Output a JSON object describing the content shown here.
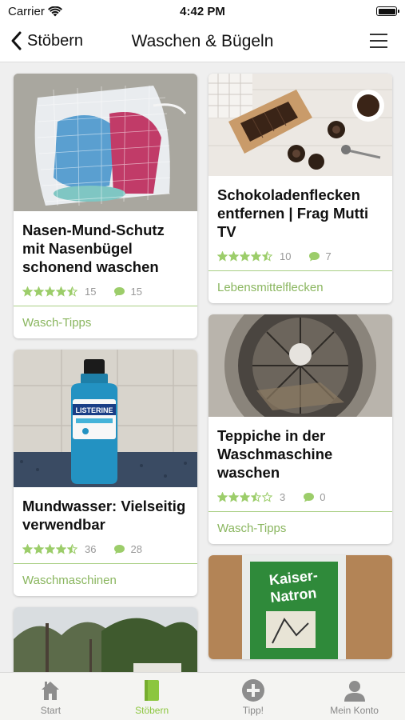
{
  "status": {
    "carrier": "Carrier",
    "time": "4:42 PM"
  },
  "nav": {
    "back_label": "Stöbern",
    "title": "Waschen & Bügeln"
  },
  "cards_left": [
    {
      "title": "Nasen-Mund-Schutz mit Nasenbügel schonend waschen",
      "rating": 4.5,
      "rating_count": "15",
      "comment_count": "15",
      "category": "Wasch-Tipps",
      "image": "mesh-laundry-bag-with-masks"
    },
    {
      "title": "Mundwasser: Vielseitig verwendbar",
      "rating": 4.5,
      "rating_count": "36",
      "comment_count": "28",
      "category": "Waschmaschinen",
      "image": "listerine-mouthwash-bottle"
    },
    {
      "image": "garden-trees"
    }
  ],
  "cards_right": [
    {
      "title": "Schokoladenflecken entfernen | Frag Mutti TV",
      "rating": 4.5,
      "rating_count": "10",
      "comment_count": "7",
      "category": "Lebensmittelflecken",
      "image": "chocolate-and-cookies"
    },
    {
      "title": "Teppiche in der Waschmaschine waschen",
      "rating": 3.5,
      "rating_count": "3",
      "comment_count": "0",
      "category": "Wasch-Tipps",
      "image": "washing-machine-drum"
    },
    {
      "image": "kaiser-natron-package"
    }
  ],
  "tabs": [
    {
      "label": "Start",
      "icon": "house-icon",
      "active": false
    },
    {
      "label": "Stöbern",
      "icon": "book-icon",
      "active": true
    },
    {
      "label": "Tipp!",
      "icon": "plus-circle-icon",
      "active": false
    },
    {
      "label": "Mein Konto",
      "icon": "user-icon",
      "active": false
    }
  ],
  "colors": {
    "accent": "#8cc63f",
    "category_text": "#8ab65f",
    "star": "#9ccd6a",
    "divider": "#a9cf84"
  }
}
